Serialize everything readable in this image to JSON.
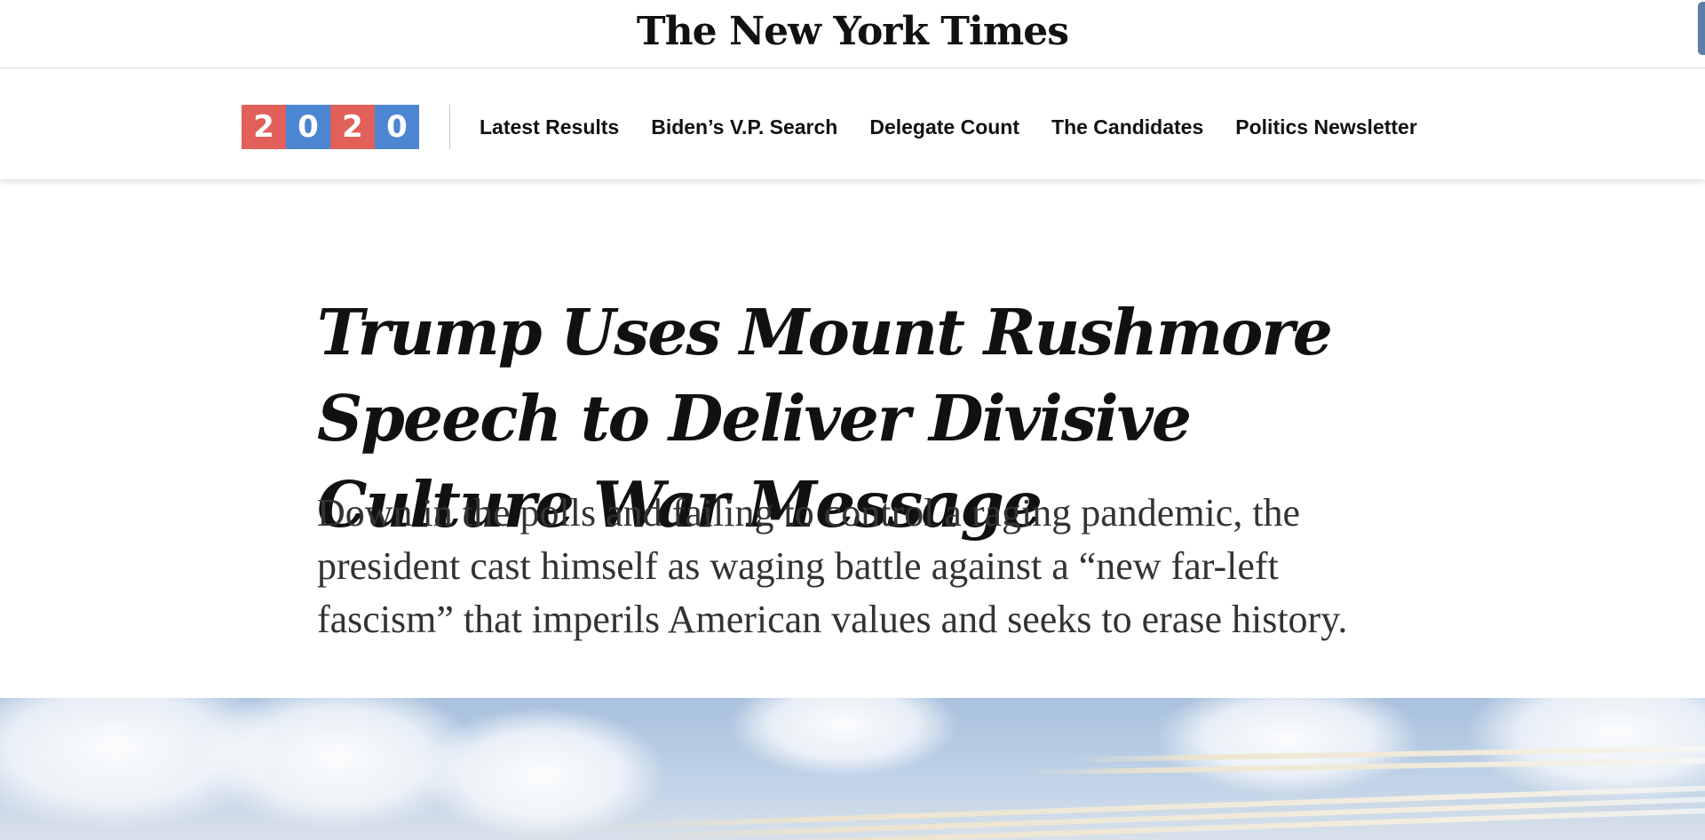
{
  "masthead": {
    "logo_text": "The New York Times"
  },
  "section_nav": {
    "brand_digits": [
      {
        "digit": "2",
        "color": "#e1605a"
      },
      {
        "digit": "0",
        "color": "#4c86d3"
      },
      {
        "digit": "2",
        "color": "#e1605a"
      },
      {
        "digit": "0",
        "color": "#4c86d3"
      }
    ],
    "links": [
      "Latest Results",
      "Biden’s V.P. Search",
      "Delegate Count",
      "The Candidates",
      "Politics Newsletter"
    ]
  },
  "article": {
    "headline": "Trump Uses Mount Rushmore Speech to Deliver Divisive Culture War Message",
    "summary": "Down in the polls and failing to control a raging pandemic, the president cast himself as waging battle against a “new far-left fascism” that imperils American values and seeks to erase history."
  }
}
